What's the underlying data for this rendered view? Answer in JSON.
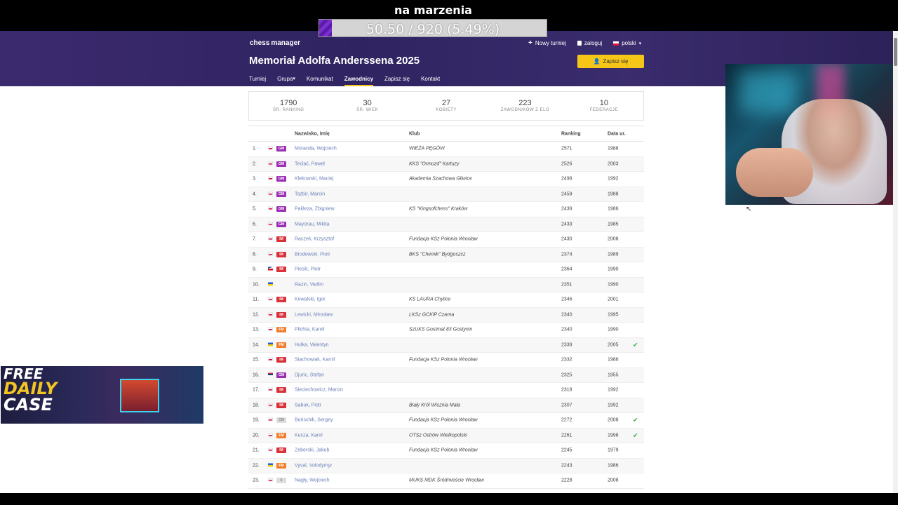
{
  "overlay": {
    "goal_title": "na marzenia",
    "goal_text": "50.50 / 920 (5.49%)",
    "goal_progress": 0.0549
  },
  "header": {
    "logo": "chess manager",
    "title": "Memoriał Adolfa Anderssena 2025",
    "new_tournament": "Nowy turniej",
    "login": "zaloguj",
    "language": "polski",
    "signup": "Zapisz się",
    "nav": [
      "Turniej",
      "Grupa",
      "Komunikat",
      "Zawodnicy",
      "Zapisz się",
      "Kontakt"
    ],
    "active_nav": "Zawodnicy"
  },
  "stats": [
    {
      "value": "1790",
      "label": "ŚR. RANKING"
    },
    {
      "value": "30",
      "label": "ŚR. WIEK"
    },
    {
      "value": "27",
      "label": "KOBIETY"
    },
    {
      "value": "223",
      "label": "ZAWODNIKÓW Z ELO"
    },
    {
      "value": "10",
      "label": "FEDERACJE"
    }
  ],
  "table": {
    "headers": {
      "name": "Nazwisko, Imię",
      "club": "Klub",
      "ranking": "Ranking",
      "birth": "Data ur."
    },
    "rows": [
      {
        "num": "1.",
        "flag": "pl",
        "title": "GM",
        "name": "Moranda, Wojciech",
        "club": "WIEŻA PĘGÓW",
        "ranking": "2571",
        "year": "1988",
        "check": ""
      },
      {
        "num": "2.",
        "flag": "pl",
        "title": "GM",
        "name": "Teclać, Paweł",
        "club": "KKS \"Ormuzd\" Kartuzy",
        "ranking": "2526",
        "year": "2003",
        "check": ""
      },
      {
        "num": "3.",
        "flag": "pl",
        "title": "GM",
        "name": "Klekowski, Maciej",
        "club": "Akademia Szachowa Gliwice",
        "ranking": "2498",
        "year": "1992",
        "check": ""
      },
      {
        "num": "4.",
        "flag": "pl",
        "title": "GM",
        "name": "Tazbir, Marcin",
        "club": "",
        "ranking": "2459",
        "year": "1988",
        "check": ""
      },
      {
        "num": "5.",
        "flag": "pl",
        "title": "GM",
        "name": "Paklezа, Zbigniew",
        "club": "KS \"Kingsofchess\" Kraków",
        "ranking": "2439",
        "year": "1986",
        "check": ""
      },
      {
        "num": "6.",
        "flag": "pl",
        "title": "GM",
        "name": "Mayorau, Mikita",
        "club": "",
        "ranking": "2433",
        "year": "1985",
        "check": ""
      },
      {
        "num": "7.",
        "flag": "pl",
        "title": "IM",
        "name": "Raczek, Krzysztof",
        "club": "Fundacja KSz Polonia Wrocław",
        "ranking": "2430",
        "year": "2008",
        "check": ""
      },
      {
        "num": "8.",
        "flag": "pl",
        "title": "IM",
        "name": "Brodowski, Piotr",
        "club": "BKS \"Chemik\" Bydgoszcz",
        "ranking": "2374",
        "year": "1989",
        "check": ""
      },
      {
        "num": "9.",
        "flag": "cz",
        "title": "IM",
        "name": "Piesik, Piotr",
        "club": "",
        "ranking": "2364",
        "year": "1990",
        "check": ""
      },
      {
        "num": "10.",
        "flag": "ua",
        "title": "",
        "name": "Razin, Vadim",
        "club": "",
        "ranking": "2351",
        "year": "1990",
        "check": ""
      },
      {
        "num": "11.",
        "flag": "pl",
        "title": "IM",
        "name": "Kowalski, Igor",
        "club": "KS LAURA Chylice",
        "ranking": "2346",
        "year": "2001",
        "check": ""
      },
      {
        "num": "12.",
        "flag": "pl",
        "title": "IM",
        "name": "Lewicki, Mirosław",
        "club": "LKSz GCKiP Czarna",
        "ranking": "2340",
        "year": "1995",
        "check": ""
      },
      {
        "num": "13.",
        "flag": "pl",
        "title": "FM",
        "name": "Plichta, Kamil",
        "club": "SzUKS Gostmat 83 Gostynin",
        "ranking": "2340",
        "year": "1990",
        "check": ""
      },
      {
        "num": "14.",
        "flag": "ua",
        "title": "FM",
        "name": "Hulka, Valentyn",
        "club": "",
        "ranking": "2339",
        "year": "2005",
        "check": "✔"
      },
      {
        "num": "15.",
        "flag": "pl",
        "title": "IM",
        "name": "Stachowiak, Kamil",
        "club": "Fundacja KSz Polonia Wrocław",
        "ranking": "2332",
        "year": "1986",
        "check": ""
      },
      {
        "num": "16.",
        "flag": "rs",
        "title": "GM",
        "name": "Djuric, Stefan",
        "club": "",
        "ranking": "2325",
        "year": "1955",
        "check": ""
      },
      {
        "num": "17.",
        "flag": "pl",
        "title": "IM",
        "name": "Sieciechowicz, Marcin",
        "club": "",
        "ranking": "2318",
        "year": "1992",
        "check": ""
      },
      {
        "num": "18.",
        "flag": "pl",
        "title": "IM",
        "name": "Sabuk, Piotr",
        "club": "Biały Król Wisznia Mała",
        "ranking": "2307",
        "year": "1992",
        "check": ""
      },
      {
        "num": "19.",
        "flag": "pl",
        "title": "CM",
        "name": "Borischik, Sergey",
        "club": "Fundacja KSz Polonia Wrocław",
        "ranking": "2272",
        "year": "2008",
        "check": "✔"
      },
      {
        "num": "20.",
        "flag": "pl",
        "title": "FM",
        "name": "Kucza, Karol",
        "club": "OTSz Ostrów Wielkopolski",
        "ranking": "2261",
        "year": "1998",
        "check": "✔"
      },
      {
        "num": "21.",
        "flag": "pl",
        "title": "IM",
        "name": "Zeberski, Jakub",
        "club": "Fundacja KSz Polonia Wrocław",
        "ranking": "2245",
        "year": "1979",
        "check": ""
      },
      {
        "num": "22.",
        "flag": "ua",
        "title": "FM",
        "name": "Vyval, Volodymyr",
        "club": "",
        "ranking": "2243",
        "year": "1986",
        "check": ""
      },
      {
        "num": "23.",
        "flag": "pl",
        "title": "k",
        "name": "Nagły, Wojciech",
        "club": "MUKS MDK Śródmieście Wrocław",
        "ranking": "2228",
        "year": "2008",
        "check": ""
      }
    ]
  },
  "ad": {
    "line1": "FREE",
    "line2": "DAILY",
    "line3": "CASE"
  },
  "colors": {
    "header": "#2f2461",
    "accent": "#f5c518",
    "link": "#6a7fb8",
    "gm": "#9b30b4",
    "im": "#d8313a",
    "fm": "#f07f2e",
    "check": "#3cae3c"
  }
}
